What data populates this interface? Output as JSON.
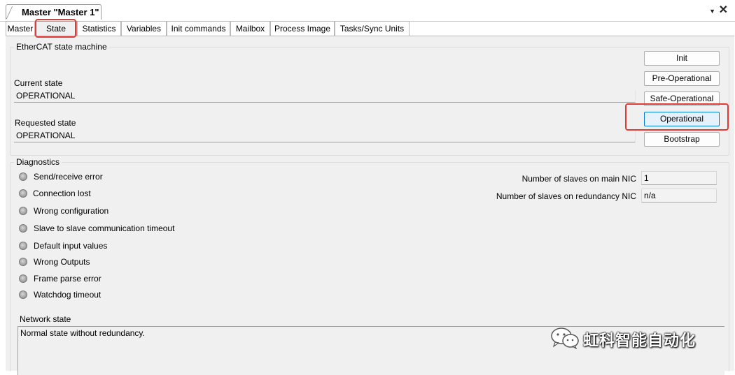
{
  "window": {
    "doc_tab_title": "Master \"Master 1\"",
    "dropdown_glyph": "▼",
    "close_glyph": "✕"
  },
  "tabs": [
    {
      "label": "Master"
    },
    {
      "label": "State"
    },
    {
      "label": "Statistics"
    },
    {
      "label": "Variables"
    },
    {
      "label": "Init commands"
    },
    {
      "label": "Mailbox"
    },
    {
      "label": "Process Image"
    },
    {
      "label": "Tasks/Sync Units"
    }
  ],
  "active_tab": "State",
  "state_machine": {
    "group_title": "EtherCAT state machine",
    "current_state_label": "Current state",
    "current_state_value": "OPERATIONAL",
    "requested_state_label": "Requested state",
    "requested_state_value": "OPERATIONAL",
    "buttons": [
      {
        "label": "Init"
      },
      {
        "label": "Pre-Operational"
      },
      {
        "label": "Safe-Operational"
      },
      {
        "label": "Operational"
      },
      {
        "label": "Bootstrap"
      }
    ],
    "focused_button": "Operational"
  },
  "diagnostics": {
    "group_title": "Diagnostics",
    "items": [
      {
        "label": "Send/receive error"
      },
      {
        "label": "Connection lost"
      },
      {
        "label": "Wrong configuration"
      },
      {
        "label": "Slave to slave communication timeout"
      },
      {
        "label": "Default input values"
      },
      {
        "label": "Wrong Outputs"
      },
      {
        "label": "Frame parse error"
      },
      {
        "label": "Watchdog timeout"
      }
    ],
    "slaves_main_label": "Number of slaves on main NIC",
    "slaves_main_value": "1",
    "slaves_redundancy_label": "Number of slaves on redundancy NIC",
    "slaves_redundancy_value": "n/a"
  },
  "network_state": {
    "label": "Network state",
    "text": "Normal state without redundancy."
  },
  "watermark": {
    "text": "虹科智能自动化",
    "logo_icon": "wechat-logo-icon"
  },
  "colors": {
    "panel_bg": "#f0f0f0",
    "highlight_red": "#e53935",
    "focus_blue": "#0078d7",
    "led_gray": "#a8a8a8"
  }
}
